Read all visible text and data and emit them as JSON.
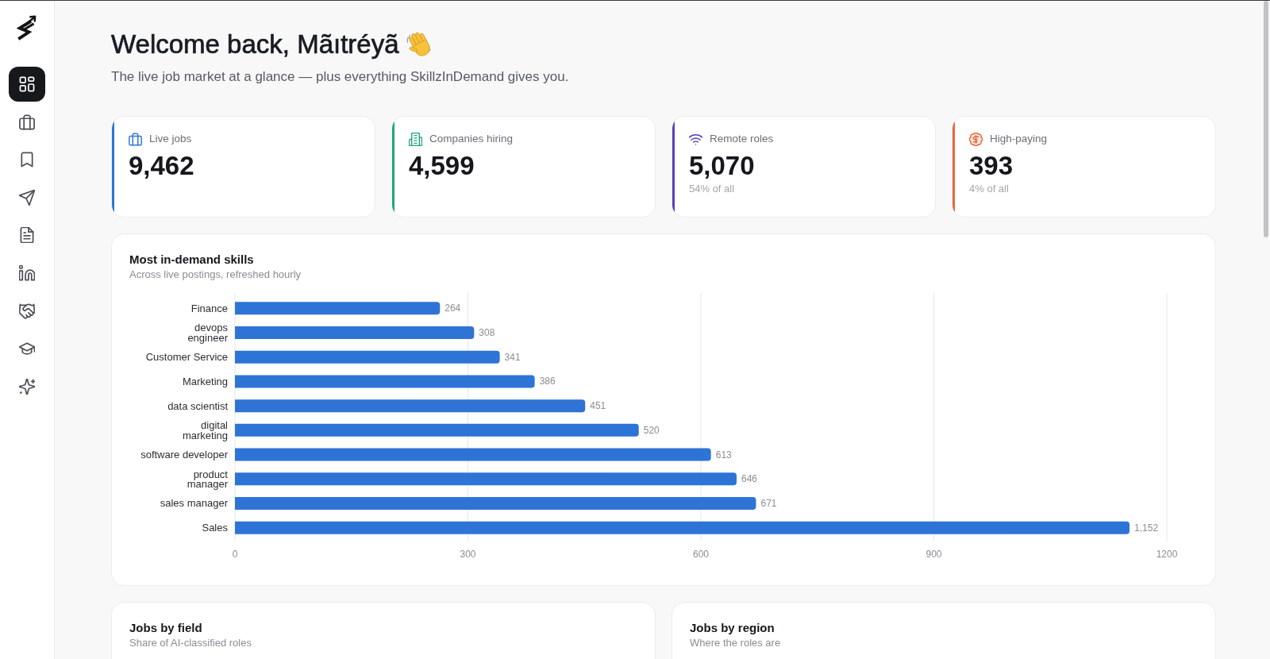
{
  "sidebar": {
    "items": [
      {
        "selected": true
      },
      {
        "selected": false
      },
      {
        "selected": false
      },
      {
        "selected": false
      },
      {
        "selected": false
      },
      {
        "selected": false
      },
      {
        "selected": false
      },
      {
        "selected": false
      },
      {
        "selected": false
      }
    ]
  },
  "header": {
    "title": "Welcome back, Mãıtréyã",
    "subtitle": "The live job market at a glance — plus everything SkillzInDemand gives you."
  },
  "stats": [
    {
      "label": "Live jobs",
      "value": "9,462",
      "color": "#2f74d0"
    },
    {
      "label": "Companies hiring",
      "value": "4,599",
      "color": "#1fa67a"
    },
    {
      "label": "Remote roles",
      "value": "5,070",
      "note": "54% of all",
      "color": "#5b3fb8"
    },
    {
      "label": "High-paying",
      "value": "393",
      "note": "4% of all",
      "color": "#e8683a"
    }
  ],
  "skills_panel": {
    "title": "Most in-demand skills",
    "subtitle": "Across live postings, refreshed hourly",
    "chart_data": {
      "type": "bar",
      "orientation": "horizontal",
      "categories": [
        "Finance",
        "devops\nengineer",
        "Customer Service",
        "Marketing",
        "data scientist",
        "digital\nmarketing",
        "software developer",
        "product\nmanager",
        "sales manager",
        "Sales"
      ],
      "values": [
        264,
        308,
        341,
        386,
        451,
        520,
        613,
        646,
        671,
        1152
      ],
      "data_labels": true,
      "value_labels": [
        "264",
        "308",
        "341",
        "386",
        "451",
        "520",
        "613",
        "646",
        "671",
        "1,152"
      ],
      "color": "#2e74d6",
      "xlim": [
        0,
        1200
      ],
      "xticks": [
        0,
        300,
        600,
        900,
        1200
      ],
      "grid": true
    }
  },
  "panels": [
    {
      "title": "Jobs by field",
      "subtitle": "Share of AI-classified roles"
    },
    {
      "title": "Jobs by region",
      "subtitle": "Where the roles are"
    }
  ]
}
